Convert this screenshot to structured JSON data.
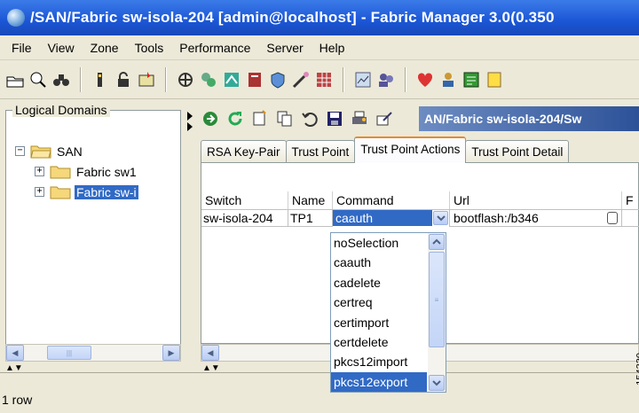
{
  "window": {
    "title": "/SAN/Fabric sw-isola-204 [admin@localhost] - Fabric Manager 3.0(0.350"
  },
  "menu": [
    "File",
    "View",
    "Zone",
    "Tools",
    "Performance",
    "Server",
    "Help"
  ],
  "left_panel": {
    "legend": "Logical Domains",
    "tree": {
      "root_label": "SAN",
      "root_expander": "−",
      "children": [
        {
          "label": "Fabric sw1",
          "expander": "+"
        },
        {
          "label": "Fabric sw-i",
          "expander": "+"
        }
      ]
    }
  },
  "right_panel": {
    "path_title": "AN/Fabric sw-isola-204/Sw",
    "tabs": [
      "RSA Key-Pair",
      "Trust Point",
      "Trust Point Actions",
      "Trust Point Detail"
    ],
    "active_tab": "Trust Point Actions",
    "table": {
      "columns": [
        "Switch",
        "Name",
        "Command",
        "Url",
        "F"
      ],
      "rows": [
        {
          "switch": "sw-isola-204",
          "name": "TP1",
          "command": "caauth",
          "url": "bootflash:/b346"
        }
      ]
    },
    "command_dropdown": {
      "options": [
        "noSelection",
        "caauth",
        "cadelete",
        "certreq",
        "certimport",
        "certdelete",
        "pkcs12import",
        "pkcs12export"
      ],
      "selected": "pkcs12export"
    }
  },
  "status": {
    "text": "1 row"
  },
  "figure_id": "154330",
  "colors": {
    "title_bar": "#1b56d6",
    "selection": "#316ac5",
    "chrome": "#ece9d8",
    "active_tab_accent": "#e68b2c"
  }
}
